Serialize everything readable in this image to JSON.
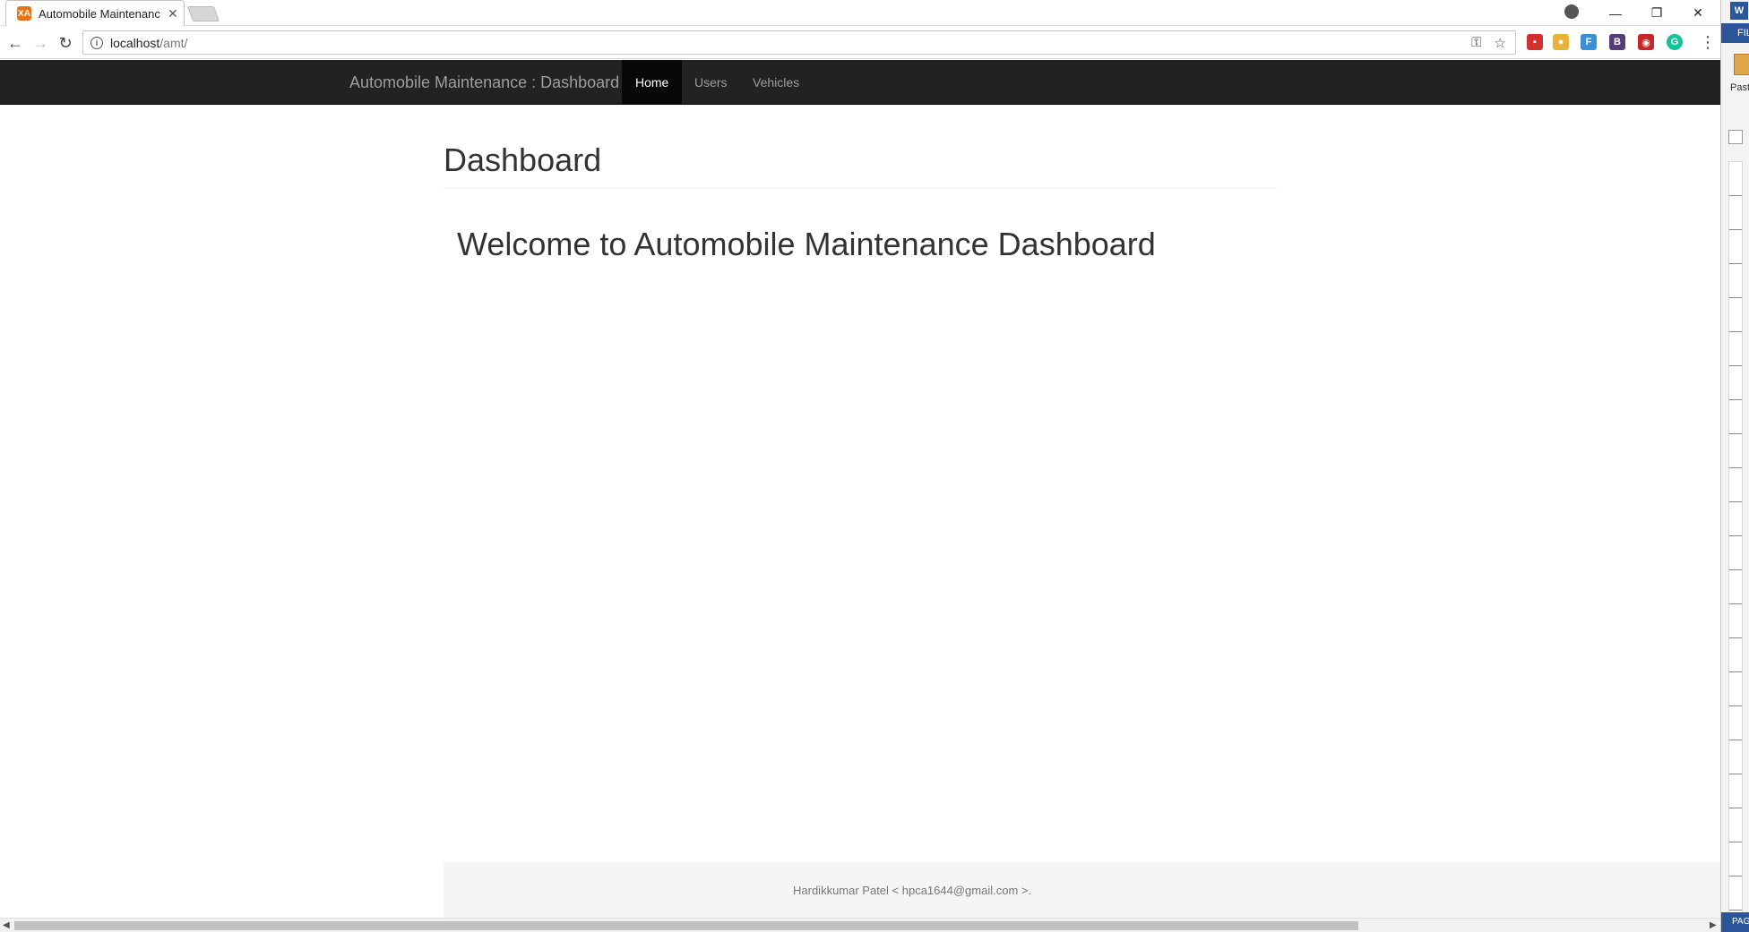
{
  "browser": {
    "tab_title": "Automobile Maintenance",
    "tab_favicon": "XA",
    "url_host": "localhost",
    "url_path": "/amt/",
    "icons": [
      "back-arrow-icon",
      "forward-arrow-icon",
      "reload-icon",
      "info-icon",
      "key-icon",
      "star-icon",
      "menu-dots-icon"
    ]
  },
  "word": {
    "app_icon": "W",
    "file_tab": "FIL",
    "paste_label": "Past",
    "page_label": "PAGE"
  },
  "navbar": {
    "brand": "Automobile Maintenance : Dashboard",
    "items": [
      {
        "label": "Home",
        "active": true
      },
      {
        "label": "Users",
        "active": false
      },
      {
        "label": "Vehicles",
        "active": false
      }
    ]
  },
  "main": {
    "page_title": "Dashboard",
    "welcome": "Welcome to Automobile Maintenance Dashboard"
  },
  "footer": {
    "text": "Hardikkumar Patel < hpca1644@gmail.com >."
  },
  "colors": {
    "navbar_bg": "#222222",
    "navbar_active_bg": "#080808",
    "nav_text": "#9d9d9d",
    "footer_bg": "#f5f5f5",
    "word_blue": "#2b579a"
  }
}
